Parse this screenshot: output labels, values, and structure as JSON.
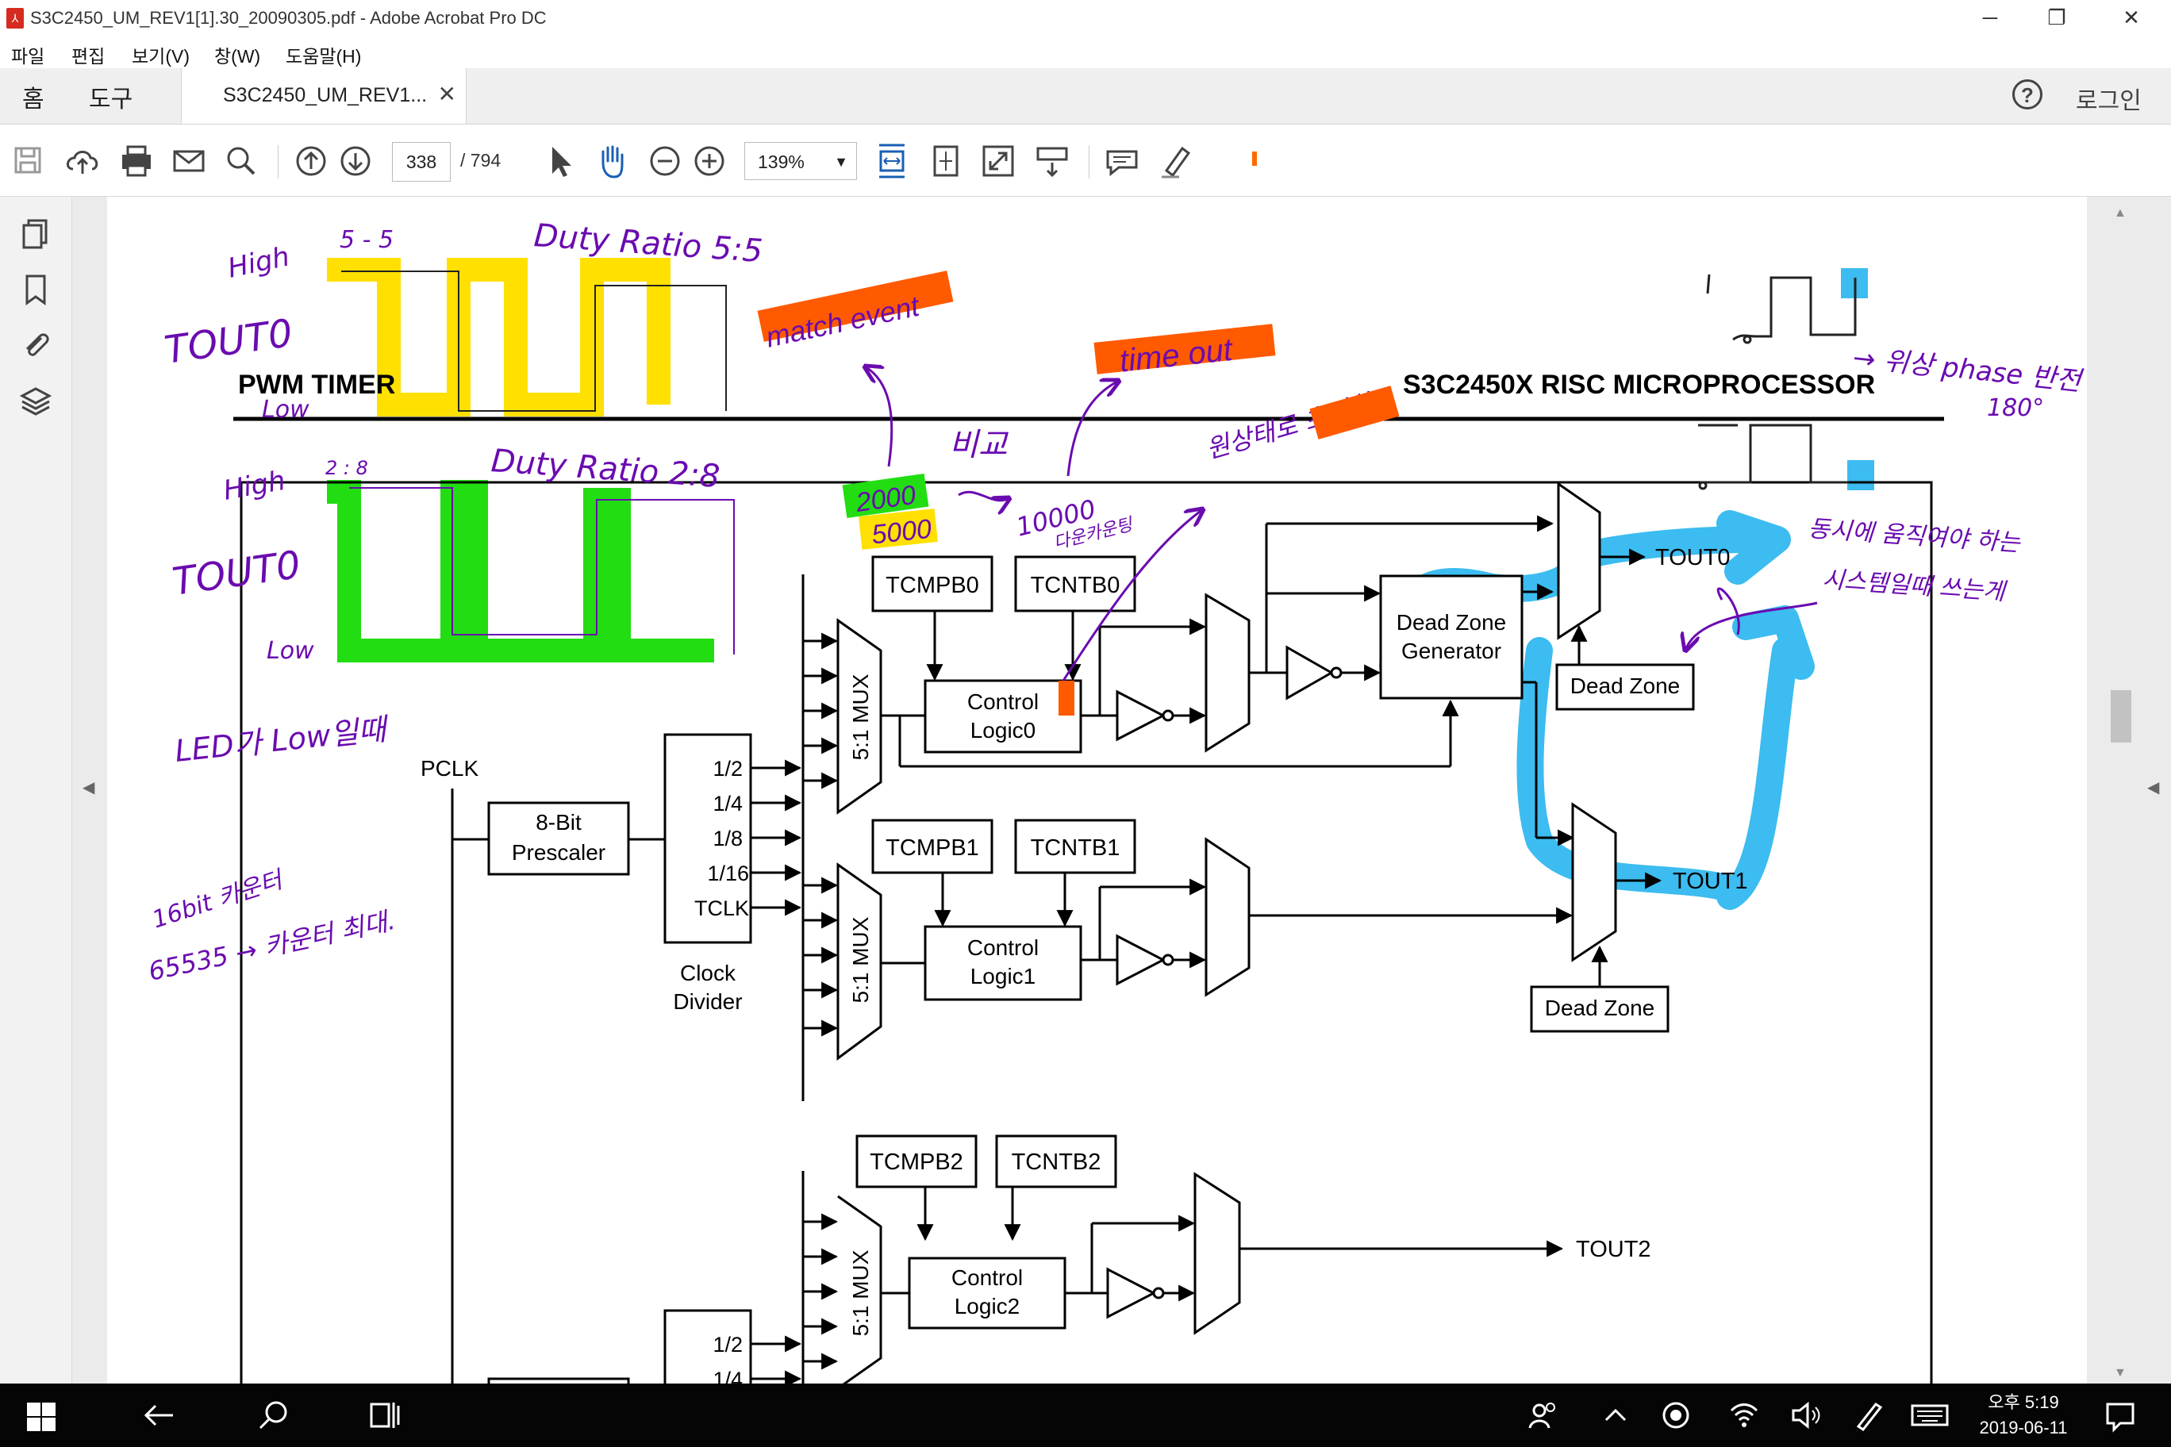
{
  "window": {
    "title": "S3C2450_UM_REV1[1].30_20090305.pdf - Adobe Acrobat Pro DC",
    "minimize": "─",
    "restore": "❐",
    "close": "✕"
  },
  "menu": [
    "파일",
    "편집",
    "보기(V)",
    "창(W)",
    "도움말(H)"
  ],
  "tabs": {
    "home": "홈",
    "tools": "도구",
    "document": "S3C2450_UM_REV1...",
    "close": "✕",
    "help": "?",
    "login": "로그인"
  },
  "toolbar": {
    "page_current": "338",
    "page_total": "/ 794",
    "zoom": "139%",
    "zoom_arrow": "▼"
  },
  "diagram": {
    "header_left": "PWM TIMER",
    "header_right": "S3C2450X RISC MICROPROCESSOR",
    "pclk": "PCLK",
    "prescaler": [
      "8-Bit",
      "Prescaler"
    ],
    "divider_outputs": [
      "1/2",
      "1/4",
      "1/8",
      "1/16",
      "TCLK"
    ],
    "clock_divider": [
      "Clock",
      "Divider"
    ],
    "divider2_outputs": [
      "1/2",
      "1/4"
    ],
    "mux": "5:1 MUX",
    "tcmpb0": "TCMPB0",
    "tcntb0": "TCNTB0",
    "control0": [
      "Control",
      "Logic0"
    ],
    "dzgen": [
      "Dead Zone",
      "Generator"
    ],
    "dead_zone": "Dead Zone",
    "tout0": "TOUT0",
    "tcmpb1": "TCMPB1",
    "tcntb1": "TCNTB1",
    "control1": [
      "Control",
      "Logic1"
    ],
    "tout1": "TOUT1",
    "tcmpb2": "TCMPB2",
    "tcntb2": "TCNTB2",
    "control2": [
      "Control",
      "Logic2"
    ],
    "tout2": "TOUT2"
  },
  "annotations": {
    "high1": "High",
    "low1": "Low",
    "tout0_label": "TOUT0",
    "duty1": "Duty Ratio 5:5",
    "five_five": "5 - 5",
    "high2": "High",
    "low2": "Low",
    "tout0_label2": "TOUT0",
    "duty2": "Duty Ratio 2:8",
    "two_eight": "2 : 8",
    "match_event": "match event",
    "time_out": "time out",
    "num_2000": "2000",
    "num_5000": "5000",
    "compare": "비교",
    "num_10000": "10000",
    "down_count": "다운카운팅",
    "initial": "원상태로 초기화",
    "phase": "→ 위상 phase 반전",
    "deg180": "180°",
    "led_low": "LED가 Low일때",
    "count_max": "16bit 카운터",
    "count_val": "65535 → 카운터 최대.",
    "sync_note1": "동시에 움직여야 하는",
    "sync_note2": "시스템일때 쓰는게"
  },
  "colors": {
    "yellow": "#ffe000",
    "green": "#22dd11",
    "orange": "#ff5a00",
    "cyan": "#3cbcf0",
    "pen": "#6a0bb0"
  },
  "taskbar": {
    "time": "오후 5:19",
    "date": "2019-06-11"
  }
}
